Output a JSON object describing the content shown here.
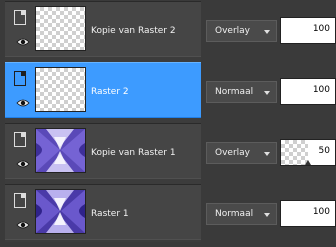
{
  "layers": [
    {
      "name": "Kopie van Raster 2",
      "blend_mode": "Overlay",
      "opacity": 100,
      "selected": false,
      "thumbnail": "transparent"
    },
    {
      "name": "Raster 2",
      "blend_mode": "Normaal",
      "opacity": 100,
      "selected": true,
      "thumbnail": "transparent"
    },
    {
      "name": "Kopie van Raster 1",
      "blend_mode": "Overlay",
      "opacity": 50,
      "selected": false,
      "thumbnail": "purple-pattern"
    },
    {
      "name": "Raster 1",
      "blend_mode": "Normaal",
      "opacity": 100,
      "selected": false,
      "thumbnail": "purple-pattern"
    }
  ],
  "colors": {
    "panel_bg": "#3a3a3a",
    "row_bg": "#454545",
    "selected_bg": "#3d9bff",
    "thumbnail_purple": "#5a49b8"
  },
  "icons": {
    "layer_type": "page-icon",
    "visibility": "eye-icon",
    "dropdown": "chevron-down-icon"
  }
}
